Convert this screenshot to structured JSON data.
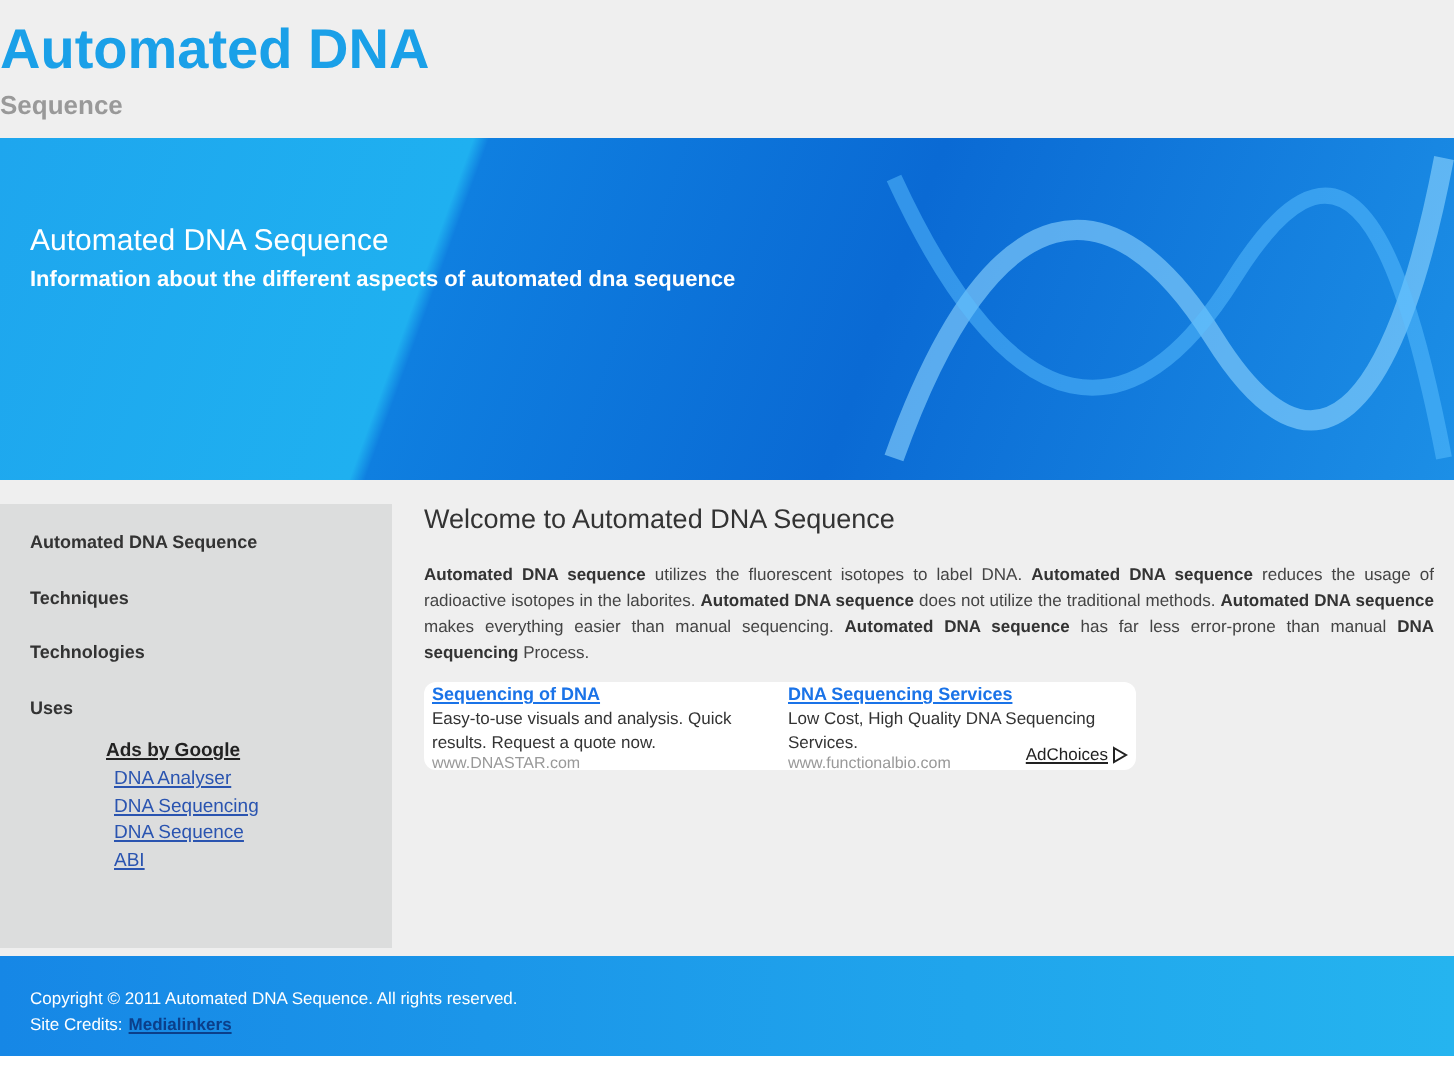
{
  "header": {
    "title": "Automated DNA",
    "subtitle": "Sequence"
  },
  "banner": {
    "title": "Automated DNA Sequence",
    "tagline": "Information about the different aspects of automated dna sequence"
  },
  "sidebar": {
    "items": [
      {
        "label": "Automated DNA Sequence"
      },
      {
        "label": "Techniques"
      },
      {
        "label": "Technologies"
      },
      {
        "label": "Uses"
      }
    ],
    "ads_title": "Ads by Google",
    "ads": [
      "DNA Analyser",
      "DNA Sequencing",
      "DNA Sequence",
      "ABI"
    ]
  },
  "main": {
    "heading": "Welcome to Automated DNA Sequence",
    "paragraph": "**Automated DNA sequence** utilizes the fluorescent isotopes to label DNA. **Automated DNA sequence** reduces the usage of radioactive isotopes in the laborites. **Automated DNA sequence** does not utilize the traditional methods. **Automated DNA sequence** makes everything easier than manual sequencing. **Automated DNA sequence** has far less error-prone than manual **DNA sequencing** Process.",
    "ads": [
      {
        "title": "Sequencing of DNA",
        "text": "Easy-to-use visuals and analysis. Quick results. Request a quote now.",
        "url": "www.DNASTAR.com"
      },
      {
        "title": "DNA Sequencing Services",
        "text": "Low Cost, High Quality DNA Sequencing Services.",
        "url": "www.functionalbio.com"
      }
    ],
    "adchoices": "AdChoices"
  },
  "footer": {
    "copyright": "Copyright © 2011 Automated DNA Sequence. All rights reserved.",
    "credits_label": "Site Credits:",
    "credits_link": "Medialinkers"
  }
}
